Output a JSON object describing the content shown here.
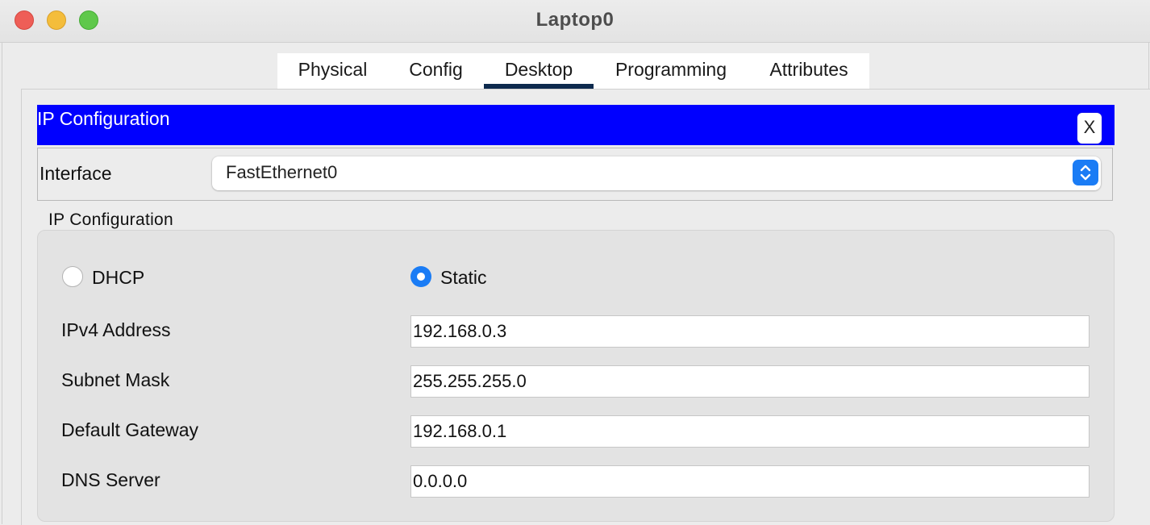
{
  "window": {
    "title": "Laptop0"
  },
  "tabs": [
    {
      "label": "Physical",
      "active": false
    },
    {
      "label": "Config",
      "active": false
    },
    {
      "label": "Desktop",
      "active": true
    },
    {
      "label": "Programming",
      "active": false
    },
    {
      "label": "Attributes",
      "active": false
    }
  ],
  "panel": {
    "title": "IP Configuration",
    "close_label": "X",
    "header_color": "#0000ff"
  },
  "interface": {
    "label": "Interface",
    "selected": "FastEthernet0"
  },
  "ip_config": {
    "group_label": "IP Configuration",
    "mode": "Static",
    "dhcp_label": "DHCP",
    "static_label": "Static",
    "fields": [
      {
        "label": "IPv4 Address",
        "value": "192.168.0.3"
      },
      {
        "label": "Subnet Mask",
        "value": "255.255.255.0"
      },
      {
        "label": "Default Gateway",
        "value": "192.168.0.1"
      },
      {
        "label": "DNS Server",
        "value": "0.0.0.0"
      }
    ]
  },
  "colors": {
    "accent": "#1a7cf5",
    "active_tab_underline": "#0d2a4e"
  }
}
